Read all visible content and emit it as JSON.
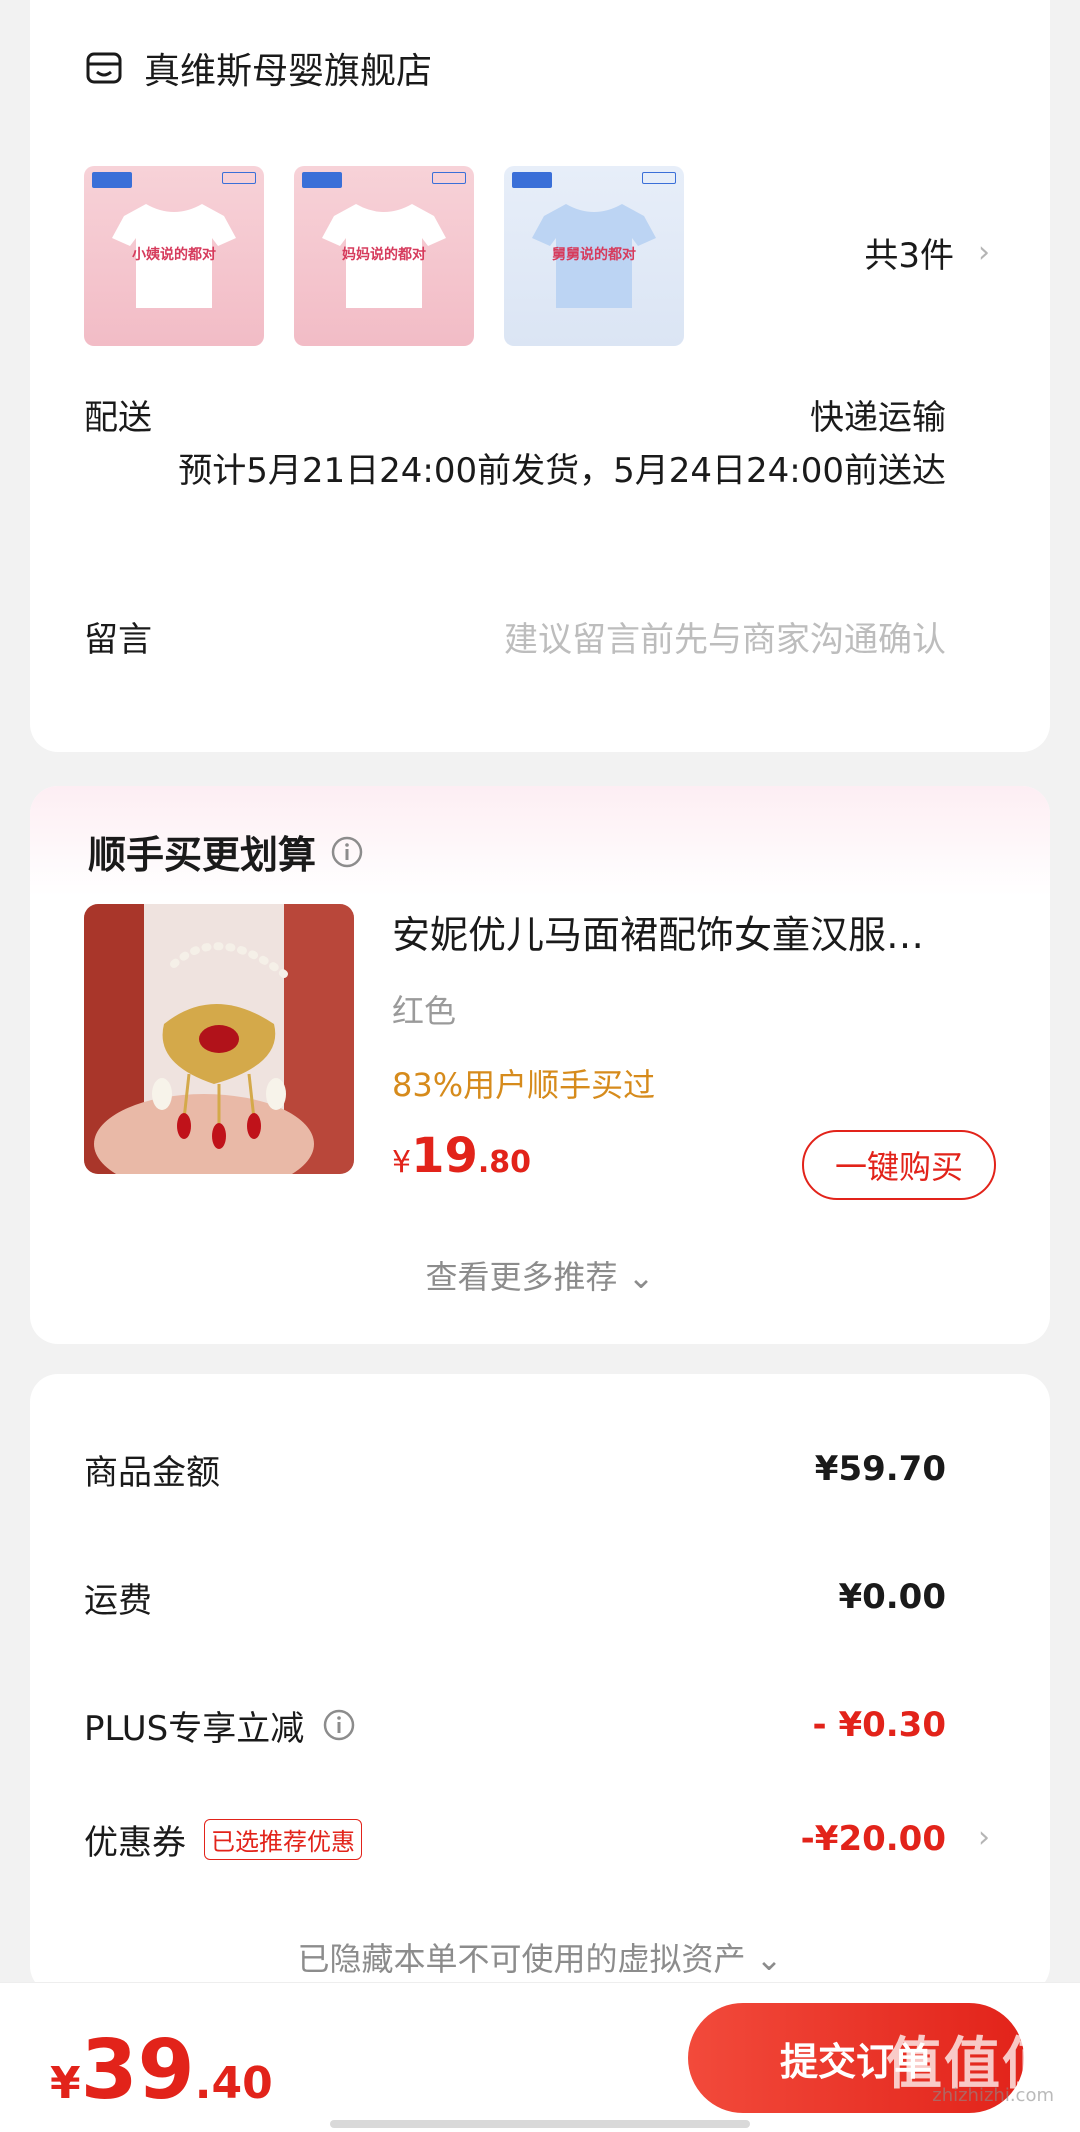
{
  "store": {
    "name": "真维斯母婴旗舰店",
    "products": [
      {
        "shirt_text": "小姨说的都对",
        "bg": "pink"
      },
      {
        "shirt_text": "妈妈说的都对",
        "bg": "pink"
      },
      {
        "shirt_text": "舅舅说的都对",
        "bg": "blue"
      }
    ],
    "count_label": "共3件"
  },
  "delivery": {
    "label": "配送",
    "method": "快递运输",
    "eta": "预计5月21日24:00前发货，5月24日24:00前送达"
  },
  "message": {
    "label": "留言",
    "placeholder": "建议留言前先与商家沟通确认"
  },
  "recommend": {
    "title": "顺手买更划算",
    "item": {
      "name": "安妮优儿马面裙配饰女童汉服…",
      "spec": "红色",
      "stat": "83%用户顺手买过",
      "price_currency": "¥",
      "price_int": "19",
      "price_dec": ".80"
    },
    "buy_label": "一键购买",
    "more_label": "查看更多推荐 ⌄"
  },
  "summary": {
    "goods_label": "商品金额",
    "goods_value": "¥59.70",
    "shipping_label": "运费",
    "shipping_value": "¥0.00",
    "plus_label": "PLUS专享立减",
    "plus_value": "- ¥0.30",
    "coupon_label": "优惠券",
    "coupon_tag": "已选推荐优惠",
    "coupon_value": "-¥20.00",
    "hidden_note": "已隐藏本单不可使用的虚拟资产 ⌄"
  },
  "footer": {
    "total_currency": "¥",
    "total_int": "39",
    "total_dec": ".40",
    "submit_label": "提交订单",
    "watermark": "值值值",
    "watermark_sub": "zhizhizhi.com"
  },
  "colors": {
    "accent_red": "#e2231a",
    "stat_orange": "#d68b1c"
  }
}
